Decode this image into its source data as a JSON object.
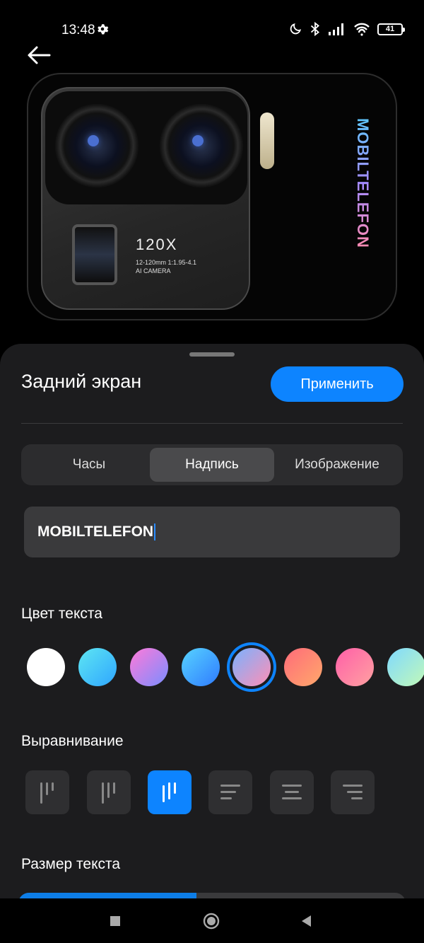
{
  "status_bar": {
    "time": "13:48",
    "battery": "41",
    "icons": [
      "gear-icon",
      "moon-icon",
      "bluetooth-icon",
      "signal-icon",
      "wifi-icon",
      "battery-icon"
    ]
  },
  "preview": {
    "brand_text": "MOBILTELEFON",
    "camera_zoom": "120X",
    "camera_spec_line1": "12-120mm 1:1.95-4.1",
    "camera_spec_line2": "AI CAMERA"
  },
  "sheet": {
    "title": "Задний экран",
    "apply_label": "Применить",
    "tabs": [
      {
        "label": "Часы",
        "active": false
      },
      {
        "label": "Надпись",
        "active": true
      },
      {
        "label": "Изображение",
        "active": false
      }
    ],
    "text_value": "MOBILTELEFON",
    "color_section_label": "Цвет текста",
    "colors": [
      {
        "name": "white",
        "fill": "#ffffff",
        "selected": false
      },
      {
        "name": "cyan",
        "fill": "linear-gradient(135deg,#5ee6f2,#2fa6ff)",
        "selected": false
      },
      {
        "name": "pink-violet",
        "fill": "linear-gradient(135deg,#ff7ad9,#7a8dff)",
        "selected": false
      },
      {
        "name": "blue",
        "fill": "linear-gradient(135deg,#57d3ff,#2f7bff)",
        "selected": false
      },
      {
        "name": "blue-pink",
        "fill": "linear-gradient(135deg,#7ab2ff,#ff8fb5)",
        "selected": true
      },
      {
        "name": "coral",
        "fill": "linear-gradient(135deg,#ff6b7a,#ffa86b)",
        "selected": false
      },
      {
        "name": "magenta",
        "fill": "linear-gradient(135deg,#ff5fa8,#ffa1a1)",
        "selected": false
      },
      {
        "name": "mint",
        "fill": "linear-gradient(135deg,#7fd9ff,#c2f9b8)",
        "selected": false
      }
    ],
    "alignment_section_label": "Выравнивание",
    "alignments": [
      {
        "name": "vertical-left",
        "active": false
      },
      {
        "name": "vertical-center",
        "active": false
      },
      {
        "name": "vertical-right",
        "active": true
      },
      {
        "name": "horizontal-left",
        "active": false
      },
      {
        "name": "horizontal-center",
        "active": false
      },
      {
        "name": "horizontal-right",
        "active": false
      }
    ],
    "size_section_label": "Размер текста",
    "size_level": 0.46
  },
  "accent_color": "#0d84ff",
  "nav": {
    "icons": [
      "recents-icon",
      "home-icon",
      "back-triangle-icon"
    ]
  }
}
